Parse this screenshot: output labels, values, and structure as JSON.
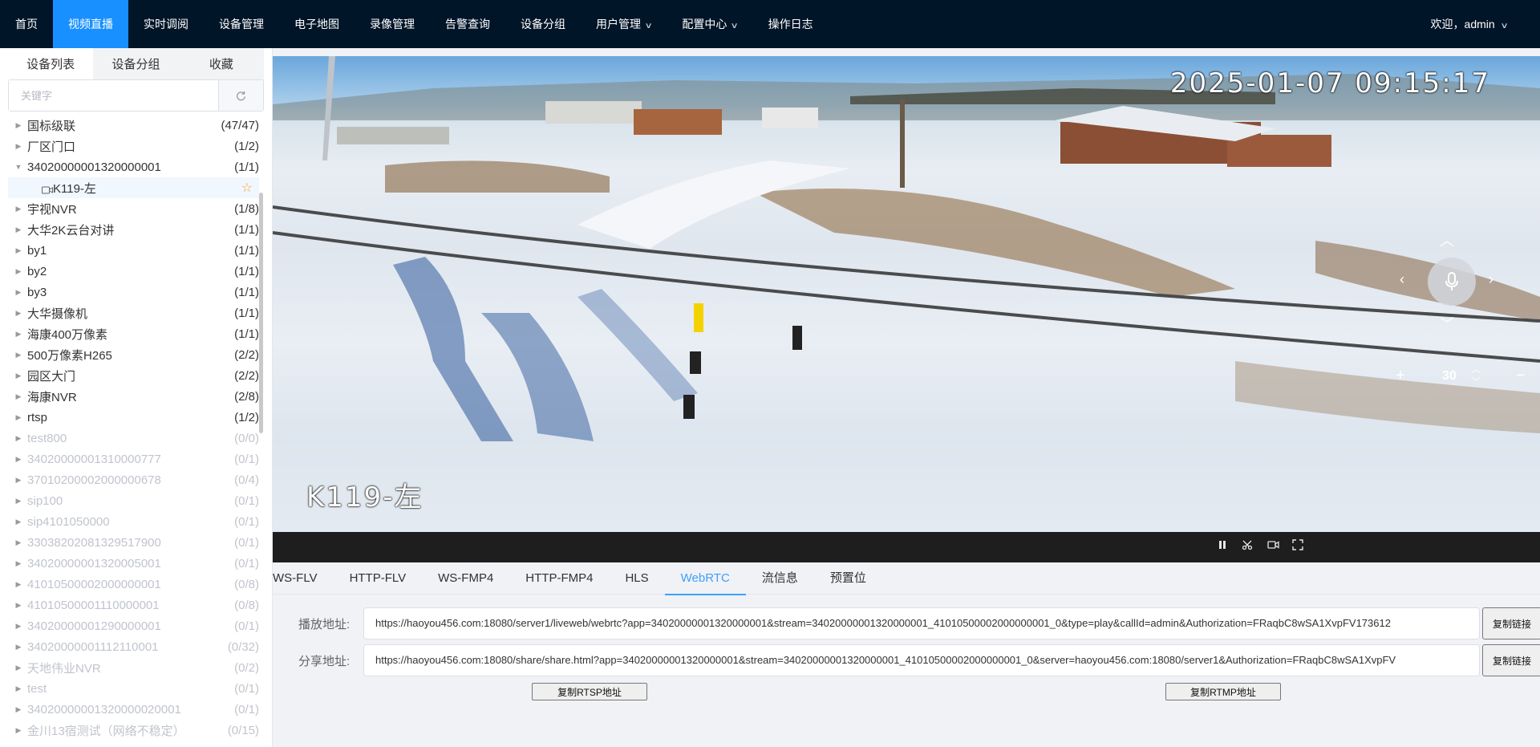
{
  "nav": {
    "items": [
      {
        "label": "首页",
        "active": false,
        "dropdown": false
      },
      {
        "label": "视频直播",
        "active": true,
        "dropdown": false
      },
      {
        "label": "实时调阅",
        "active": false,
        "dropdown": false
      },
      {
        "label": "设备管理",
        "active": false,
        "dropdown": false
      },
      {
        "label": "电子地图",
        "active": false,
        "dropdown": false
      },
      {
        "label": "录像管理",
        "active": false,
        "dropdown": false
      },
      {
        "label": "告警查询",
        "active": false,
        "dropdown": false
      },
      {
        "label": "设备分组",
        "active": false,
        "dropdown": false
      },
      {
        "label": "用户管理",
        "active": false,
        "dropdown": true
      },
      {
        "label": "配置中心",
        "active": false,
        "dropdown": true
      },
      {
        "label": "操作日志",
        "active": false,
        "dropdown": false
      }
    ],
    "welcome": "欢迎，admin"
  },
  "sidebar": {
    "tabs": [
      "设备列表",
      "设备分组",
      "收藏"
    ],
    "active_tab": 0,
    "search_placeholder": "关键字",
    "tree": [
      {
        "label": "国标级联",
        "count": "(47/47)",
        "state": "collapsed",
        "online": true
      },
      {
        "label": "厂区门口",
        "count": "(1/2)",
        "state": "collapsed",
        "online": true
      },
      {
        "label": "34020000001320000001",
        "count": "(1/1)",
        "state": "expanded",
        "online": true
      },
      {
        "label": "K119-左",
        "count": "",
        "state": "leaf",
        "online": true,
        "child": true
      },
      {
        "label": "宇视NVR",
        "count": "(1/8)",
        "state": "collapsed",
        "online": true
      },
      {
        "label": "大华2K云台对讲",
        "count": "(1/1)",
        "state": "collapsed",
        "online": true
      },
      {
        "label": "by1",
        "count": "(1/1)",
        "state": "collapsed",
        "online": true
      },
      {
        "label": "by2",
        "count": "(1/1)",
        "state": "collapsed",
        "online": true
      },
      {
        "label": "by3",
        "count": "(1/1)",
        "state": "collapsed",
        "online": true
      },
      {
        "label": "大华摄像机",
        "count": "(1/1)",
        "state": "collapsed",
        "online": true
      },
      {
        "label": "海康400万像素",
        "count": "(1/1)",
        "state": "collapsed",
        "online": true
      },
      {
        "label": "500万像素H265",
        "count": "(2/2)",
        "state": "collapsed",
        "online": true
      },
      {
        "label": "园区大门",
        "count": "(2/2)",
        "state": "collapsed",
        "online": true
      },
      {
        "label": "海康NVR",
        "count": "(2/8)",
        "state": "collapsed",
        "online": true
      },
      {
        "label": "rtsp",
        "count": "(1/2)",
        "state": "collapsed",
        "online": true
      },
      {
        "label": "test800",
        "count": "(0/0)",
        "state": "collapsed",
        "online": false
      },
      {
        "label": "34020000001310000777",
        "count": "(0/1)",
        "state": "collapsed",
        "online": false
      },
      {
        "label": "37010200002000000678",
        "count": "(0/4)",
        "state": "collapsed",
        "online": false
      },
      {
        "label": "sip100",
        "count": "(0/1)",
        "state": "collapsed",
        "online": false
      },
      {
        "label": "sip4101050000",
        "count": "(0/1)",
        "state": "collapsed",
        "online": false
      },
      {
        "label": "33038202081329517900",
        "count": "(0/1)",
        "state": "collapsed",
        "online": false
      },
      {
        "label": "34020000001320005001",
        "count": "(0/1)",
        "state": "collapsed",
        "online": false
      },
      {
        "label": "41010500002000000001",
        "count": "(0/8)",
        "state": "collapsed",
        "online": false
      },
      {
        "label": "41010500001110000001",
        "count": "(0/8)",
        "state": "collapsed",
        "online": false
      },
      {
        "label": "34020000001290000001",
        "count": "(0/1)",
        "state": "collapsed",
        "online": false
      },
      {
        "label": "34020000001112110001",
        "count": "(0/32)",
        "state": "collapsed",
        "online": false
      },
      {
        "label": "天地伟业NVR",
        "count": "(0/2)",
        "state": "collapsed",
        "online": false
      },
      {
        "label": "test",
        "count": "(0/1)",
        "state": "collapsed",
        "online": false
      },
      {
        "label": "34020000001320000020001",
        "count": "(0/1)",
        "state": "collapsed",
        "online": false
      },
      {
        "label": "金川13宿测试（网络不稳定）",
        "count": "(0/15)",
        "state": "collapsed",
        "online": false
      }
    ]
  },
  "video": {
    "timestamp": "2025-01-07 09:15:17",
    "camera_name": "K119-左",
    "zoom_value": "30"
  },
  "tabs": [
    "WS-FLV",
    "HTTP-FLV",
    "WS-FMP4",
    "HTTP-FMP4",
    "HLS",
    "WebRTC",
    "流信息",
    "预置位"
  ],
  "active_tab": 5,
  "play": {
    "label": "播放地址:",
    "url": "https://haoyou456.com:18080/server1/liveweb/webrtc?app=34020000001320000001&stream=34020000001320000001_41010500002000000001_0&type=play&callId=admin&Authorization=FRaqbC8wSA1XvpFV173612",
    "copy_label": "复制链接"
  },
  "share": {
    "label": "分享地址:",
    "url": "https://haoyou456.com:18080/share/share.html?app=34020000001320000001&stream=34020000001320000001_41010500002000000001_0&server=haoyou456.com:18080/server1&Authorization=FRaqbC8wSA1XvpFV",
    "copy_label": "复制链接"
  },
  "rtsp_button": "复制RTSP地址",
  "rtmp_button": "复制RTMP地址",
  "colors": {
    "nav_bg": "#011528",
    "accent": "#1890ff",
    "tab_active": "#409eff"
  }
}
